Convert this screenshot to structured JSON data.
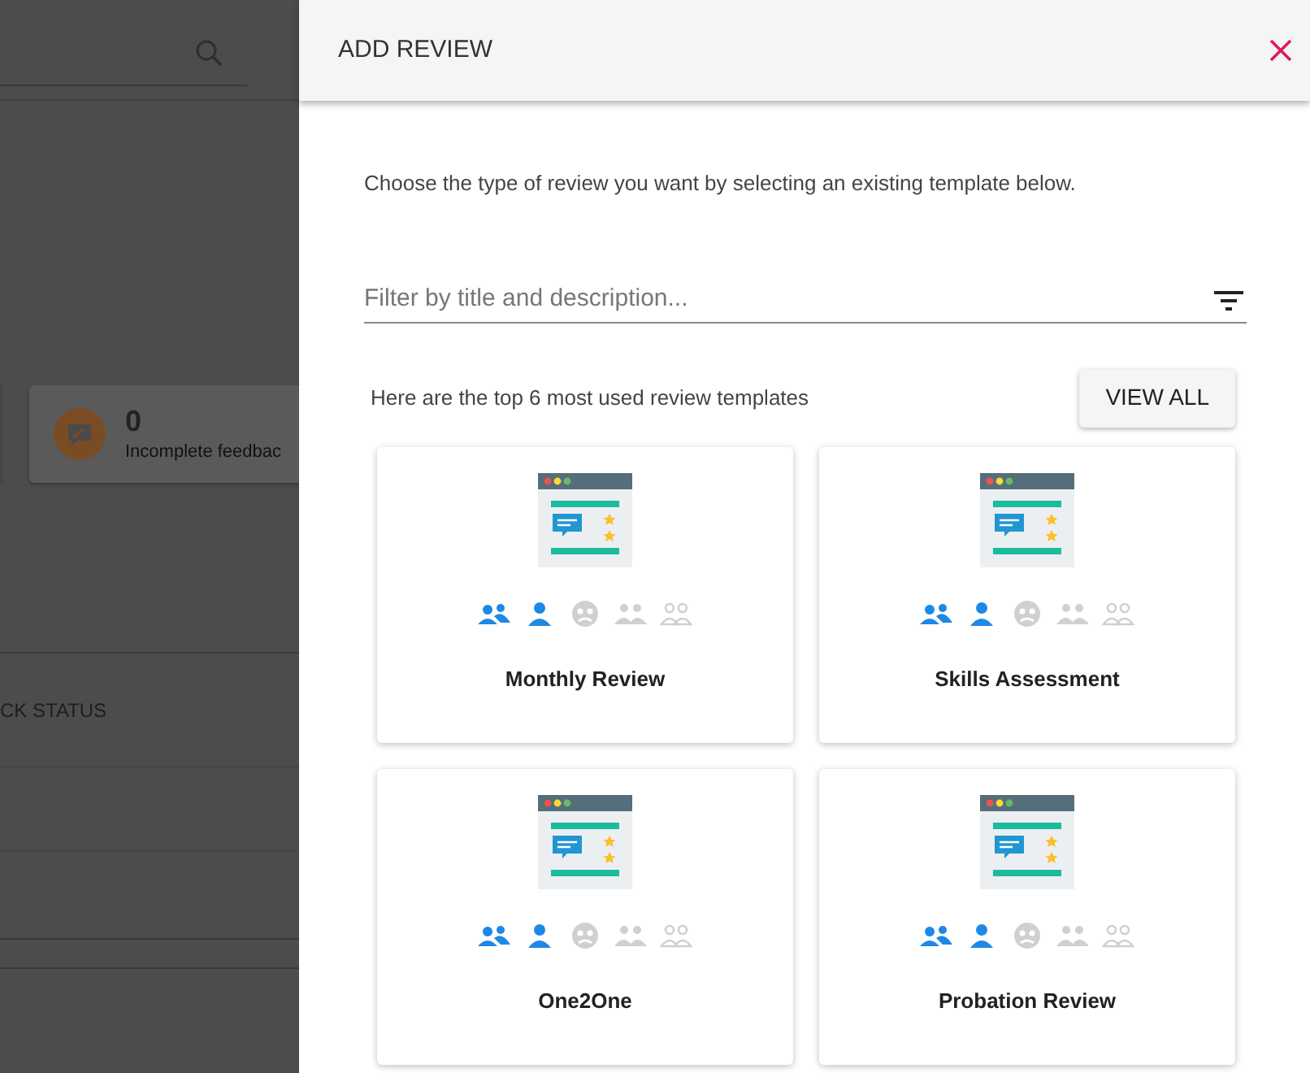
{
  "background": {
    "stat_value": "0",
    "stat_label": "Incomplete feedbac",
    "column_heading": "CK STATUS"
  },
  "panel": {
    "title": "ADD REVIEW",
    "intro": "Choose the type of review you want by selecting an existing template below.",
    "filter": {
      "placeholder": "Filter by title and description..."
    },
    "top_note": "Here are the top 6 most used review templates",
    "view_all": "VIEW ALL"
  },
  "templates": [
    {
      "title": "Monthly Review",
      "audience": [
        {
          "kind": "pair",
          "active": true
        },
        {
          "kind": "person",
          "active": true
        },
        {
          "kind": "circle",
          "active": false
        },
        {
          "kind": "group",
          "active": false
        },
        {
          "kind": "group-outline",
          "active": false
        }
      ]
    },
    {
      "title": "Skills Assessment",
      "audience": [
        {
          "kind": "pair",
          "active": true
        },
        {
          "kind": "person",
          "active": true
        },
        {
          "kind": "circle",
          "active": false
        },
        {
          "kind": "group",
          "active": false
        },
        {
          "kind": "group-outline",
          "active": false
        }
      ]
    },
    {
      "title": "One2One",
      "audience": [
        {
          "kind": "pair",
          "active": true
        },
        {
          "kind": "person",
          "active": true
        },
        {
          "kind": "circle",
          "active": false
        },
        {
          "kind": "group",
          "active": false
        },
        {
          "kind": "group-outline",
          "active": false
        }
      ]
    },
    {
      "title": "Probation Review",
      "audience": [
        {
          "kind": "pair",
          "active": true
        },
        {
          "kind": "person",
          "active": true
        },
        {
          "kind": "circle",
          "active": false
        },
        {
          "kind": "group",
          "active": false
        },
        {
          "kind": "group-outline",
          "active": false
        }
      ]
    }
  ]
}
